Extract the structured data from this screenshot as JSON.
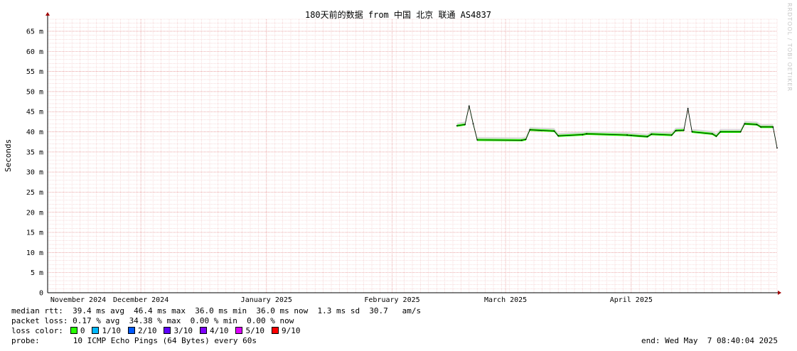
{
  "chart_data": {
    "type": "line",
    "title": "180天前的数据 from 中国 北京 联通 AS4837",
    "ylabel": "Seconds",
    "ylim": [
      0,
      0.068
    ],
    "y_ticks": [
      "0",
      "5 m",
      "10 m",
      "15 m",
      "20 m",
      "25 m",
      "30 m",
      "35 m",
      "40 m",
      "45 m",
      "50 m",
      "55 m",
      "60 m",
      "65 m"
    ],
    "x_range": [
      "2024-11-08",
      "2025-05-07"
    ],
    "x_ticks": [
      {
        "date": "2024-11-01",
        "label": "November 2024"
      },
      {
        "date": "2024-12-01",
        "label": "December 2024"
      },
      {
        "date": "2025-01-01",
        "label": "January 2025"
      },
      {
        "date": "2025-02-01",
        "label": "February 2025"
      },
      {
        "date": "2025-03-01",
        "label": "March 2025"
      },
      {
        "date": "2025-04-01",
        "label": "April 2025"
      }
    ],
    "grid": true,
    "series": [
      {
        "name": "median rtt",
        "color": "#00bb00",
        "points": [
          [
            "2025-02-17",
            41.5
          ],
          [
            "2025-02-19",
            41.8
          ],
          [
            "2025-02-20",
            46.4
          ],
          [
            "2025-02-21",
            42.0
          ],
          [
            "2025-02-22",
            38.0
          ],
          [
            "2025-03-05",
            37.9
          ],
          [
            "2025-03-06",
            38.1
          ],
          [
            "2025-03-07",
            40.5
          ],
          [
            "2025-03-13",
            40.2
          ],
          [
            "2025-03-14",
            39.0
          ],
          [
            "2025-03-20",
            39.3
          ],
          [
            "2025-03-21",
            39.5
          ],
          [
            "2025-03-31",
            39.2
          ],
          [
            "2025-04-01",
            39.1
          ],
          [
            "2025-04-05",
            38.8
          ],
          [
            "2025-04-06",
            39.4
          ],
          [
            "2025-04-11",
            39.2
          ],
          [
            "2025-04-12",
            40.3
          ],
          [
            "2025-04-14",
            40.4
          ],
          [
            "2025-04-15",
            45.8
          ],
          [
            "2025-04-16",
            40.0
          ],
          [
            "2025-04-21",
            39.5
          ],
          [
            "2025-04-22",
            38.9
          ],
          [
            "2025-04-23",
            40.0
          ],
          [
            "2025-04-28",
            40.0
          ],
          [
            "2025-04-29",
            42.0
          ],
          [
            "2025-05-02",
            41.8
          ],
          [
            "2025-05-03",
            41.2
          ],
          [
            "2025-05-06",
            41.2
          ],
          [
            "2025-05-07",
            36.0
          ]
        ]
      }
    ],
    "loss_colors": [
      {
        "label": "0",
        "color": "#26ff00"
      },
      {
        "label": "1/10",
        "color": "#00b8ff"
      },
      {
        "label": "2/10",
        "color": "#0059ff"
      },
      {
        "label": "3/10",
        "color": "#5e00ff"
      },
      {
        "label": "4/10",
        "color": "#7e00ff"
      },
      {
        "label": "5/10",
        "color": "#dd00ff"
      },
      {
        "label": "9/10",
        "color": "#ff0000"
      }
    ]
  },
  "watermark": "RRDTOOL / TOBI OETIKER",
  "legend": {
    "median_rtt": "median rtt:  39.4 ms avg  46.4 ms max  36.0 ms min  36.0 ms now  1.3 ms sd  30.7   am/s",
    "packet_loss": "packet loss: 0.17 % avg  34.38 % max  0.00 % min  0.00 % now",
    "loss_color_label": "loss color:",
    "probe_label": "probe:",
    "probe_text": "10 ICMP Echo Pings (64 Bytes) every 60s",
    "end": "end: Wed May  7 08:40:04 2025"
  }
}
